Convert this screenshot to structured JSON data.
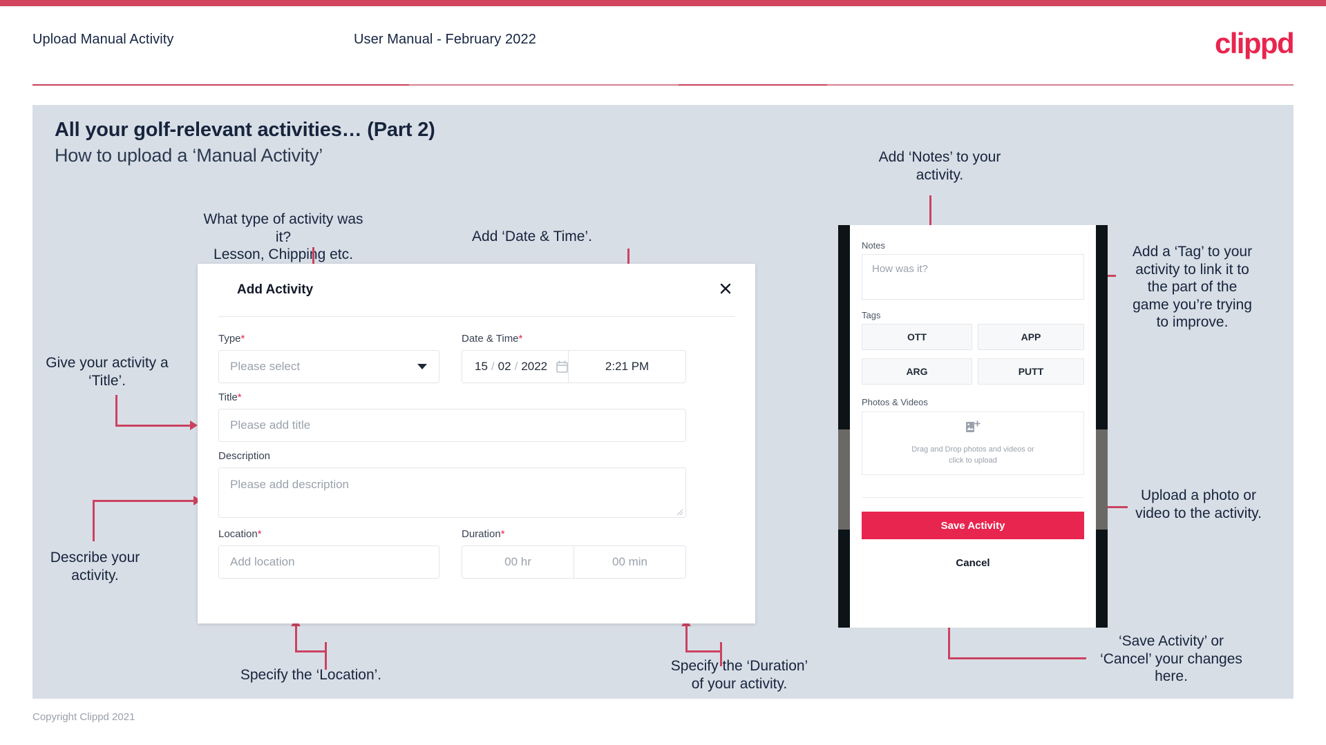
{
  "header": {
    "title": "Upload Manual Activity",
    "subtitle": "User Manual - February 2022",
    "logo": "clippd"
  },
  "slide": {
    "title": "All your golf-relevant activities… (Part 2)",
    "subtitle": "How to upload a ‘Manual Activity’"
  },
  "annotations": {
    "type": "What type of activity was it?\nLesson, Chipping etc.",
    "date_time": "Add ‘Date & Time’.",
    "title": "Give your activity a\n‘Title’.",
    "description": "Describe your\nactivity.",
    "location": "Specify the ‘Location’.",
    "duration": "Specify the ‘Duration’\nof your activity.",
    "notes": "Add ‘Notes’ to your\nactivity.",
    "tags": "Add a ‘Tag’ to your\nactivity to link it to\nthe part of the\ngame you’re trying\nto improve.",
    "photos": "Upload a photo or\nvideo to the activity.",
    "save_cancel": "‘Save Activity’ or\n‘Cancel’ your changes\nhere."
  },
  "dialog": {
    "title": "Add Activity",
    "close_icon": "close-icon",
    "fields": {
      "type": {
        "label": "Type",
        "required": "*",
        "placeholder": "Please select"
      },
      "date_time": {
        "label": "Date & Time",
        "required": "*",
        "day": "15",
        "month": "02",
        "year": "2022",
        "sep": "/",
        "time": "2:21 PM"
      },
      "title": {
        "label": "Title",
        "required": "*",
        "placeholder": "Please add title"
      },
      "description": {
        "label": "Description",
        "placeholder": "Please add description"
      },
      "location": {
        "label": "Location",
        "required": "*",
        "placeholder": "Add location"
      },
      "duration": {
        "label": "Duration",
        "required": "*",
        "hours": "00 hr",
        "minutes": "00 min"
      }
    }
  },
  "phone": {
    "notes": {
      "label": "Notes",
      "placeholder": "How was it?"
    },
    "tags": {
      "label": "Tags",
      "items": [
        "OTT",
        "APP",
        "ARG",
        "PUTT"
      ]
    },
    "photos": {
      "label": "Photos & Videos",
      "dropzone_line1": "Drag and Drop photos and videos or",
      "dropzone_line2": "click to upload",
      "icon": "add-image-icon"
    },
    "save_label": "Save Activity",
    "cancel_label": "Cancel"
  },
  "footer": {
    "copyright": "Copyright Clippd 2021"
  },
  "colors": {
    "accent": "#e8254e",
    "accent_rule": "#d1455f",
    "arrow": "#cb4260",
    "slide_bg": "#d8dee6",
    "text_dark": "#16243c"
  }
}
